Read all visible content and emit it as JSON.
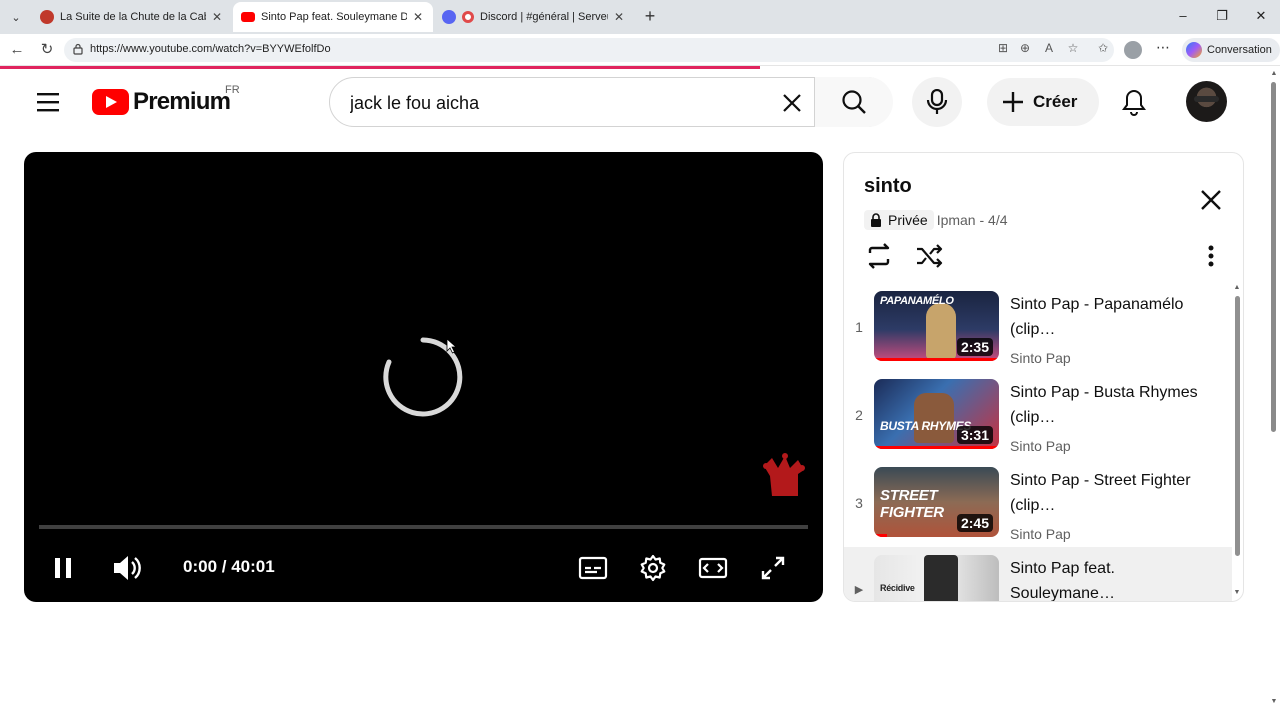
{
  "browser": {
    "tabs": [
      {
        "title": "La Suite de la Chute de la Cabale",
        "favicon_color": "#c0392b"
      },
      {
        "title": "Sinto Pap feat. Souleymane Diamanka",
        "favicon_color": "#ff0000"
      },
      {
        "title": "Discord | #général | Serveur de",
        "favicon_color": "#5865f2"
      }
    ],
    "url": "https://www.youtube.com/watch?v=BYYWEfolfDo",
    "conversation_label": "Conversation"
  },
  "masthead": {
    "logo_text": "Premium",
    "region": "FR",
    "search_value": "jack le fou aicha",
    "search_placeholder": "Rechercher",
    "create_label": "Créer"
  },
  "player": {
    "time": "0:00 / 40:01",
    "progress": 0,
    "state": "loading"
  },
  "playlist": {
    "title": "sinto",
    "privacy": "Privée",
    "owner_position": "Ipman - 4/4",
    "items": [
      {
        "index": "1",
        "title": "Sinto Pap - Papanamélo (clip…",
        "channel": "Sinto Pap",
        "duration": "2:35",
        "thumb_label": "PAPANAMÉLO",
        "thumb_colors": [
          "#1a2440",
          "#c94c7e"
        ],
        "watched": 1.0
      },
      {
        "index": "2",
        "title": "Sinto Pap - Busta Rhymes (clip…",
        "channel": "Sinto Pap",
        "duration": "3:31",
        "thumb_label": "BUSTA RHYMES",
        "thumb_colors": [
          "#1b2b57",
          "#c8313f"
        ],
        "watched": 1.0
      },
      {
        "index": "3",
        "title": "Sinto Pap - Street Fighter (clip…",
        "channel": "Sinto Pap",
        "duration": "2:45",
        "thumb_label": "STREET FIGHTER",
        "thumb_colors": [
          "#3a4a55",
          "#b0533a"
        ],
        "watched": 0.1
      },
      {
        "index": "▶",
        "title": "Sinto Pap feat. Souleymane…",
        "channel": "Sinto Pap",
        "duration": "",
        "thumb_label": "Récidive",
        "thumb_colors": [
          "#e6e6e6",
          "#bdbdbd"
        ],
        "watched": 0
      }
    ]
  },
  "colors": {
    "accent": "#ff0000",
    "load_bar": "#e0245e"
  }
}
